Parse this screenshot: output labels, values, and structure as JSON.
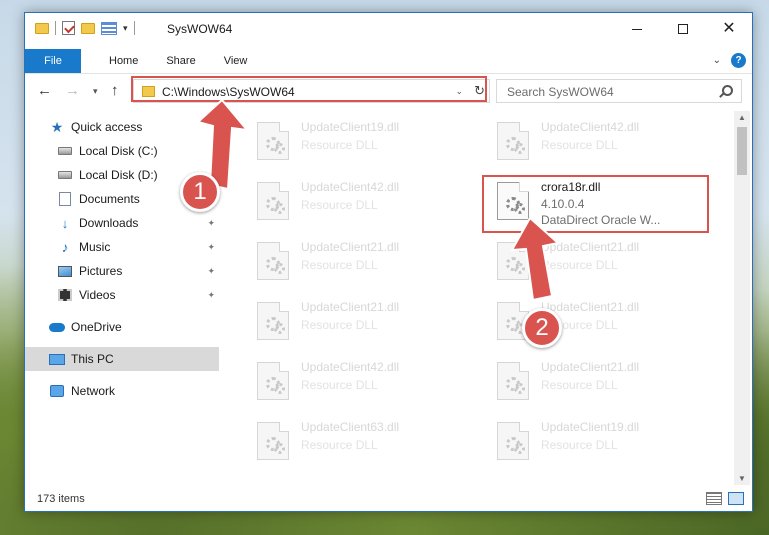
{
  "window": {
    "title": "SysWOW64",
    "controls": {
      "minimize_icon": "minimize-icon",
      "maximize_icon": "maximize-icon",
      "close_icon": "close-icon",
      "close_glyph": "✕"
    }
  },
  "ribbon": {
    "tabs": [
      {
        "label": "File"
      },
      {
        "label": "Home"
      },
      {
        "label": "Share"
      },
      {
        "label": "View"
      }
    ],
    "help_glyph": "?"
  },
  "address": {
    "path": "C:\\Windows\\SysWOW64",
    "search_placeholder": "Search SysWOW64"
  },
  "nav": {
    "items": [
      {
        "label": "Quick access",
        "icon": "star-icon"
      },
      {
        "label": "Local Disk (C:)",
        "icon": "disk-icon"
      },
      {
        "label": "Local Disk (D:)",
        "icon": "disk-icon"
      },
      {
        "label": "Documents",
        "icon": "documents-icon"
      },
      {
        "label": "Downloads",
        "icon": "downloads-icon",
        "pinned": true
      },
      {
        "label": "Music",
        "icon": "music-icon",
        "pinned": true
      },
      {
        "label": "Pictures",
        "icon": "pictures-icon",
        "pinned": true
      },
      {
        "label": "Videos",
        "icon": "videos-icon",
        "pinned": true
      },
      {
        "label": "OneDrive",
        "icon": "cloud-icon"
      },
      {
        "label": "This PC",
        "icon": "pc-icon",
        "selected": true
      },
      {
        "label": "Network",
        "icon": "network-icon"
      }
    ]
  },
  "files": {
    "left": [
      {
        "name": "UpdateClient19.dll",
        "desc": "Resource DLL"
      },
      {
        "name": "UpdateClient42.dll",
        "desc": "Resource DLL"
      },
      {
        "name": "UpdateClient21.dll",
        "desc": "Resource DLL"
      },
      {
        "name": "UpdateClient21.dll",
        "desc": "Resource DLL"
      },
      {
        "name": "UpdateClient42.dll",
        "desc": "Resource DLL"
      },
      {
        "name": "UpdateClient63.dll",
        "desc": "Resource DLL"
      }
    ],
    "right": [
      {
        "name": "UpdateClient42.dll",
        "desc": "Resource DLL"
      },
      {
        "name": "UpdateClient21.dll",
        "desc": "Resource DLL"
      },
      {
        "name": "UpdateClient21.dll",
        "desc": "Resource DLL"
      },
      {
        "name": "UpdateClient21.dll",
        "desc": "Resource DLL"
      },
      {
        "name": "UpdateClient19.dll",
        "desc": "Resource DLL"
      }
    ],
    "focused": {
      "name": "crora18r.dll",
      "version": "4.10.0.4",
      "desc": "DataDirect Oracle W..."
    }
  },
  "status": {
    "item_count": "173 items"
  },
  "annotations": {
    "step1": "1",
    "step2": "2",
    "color": "#d9534f"
  }
}
